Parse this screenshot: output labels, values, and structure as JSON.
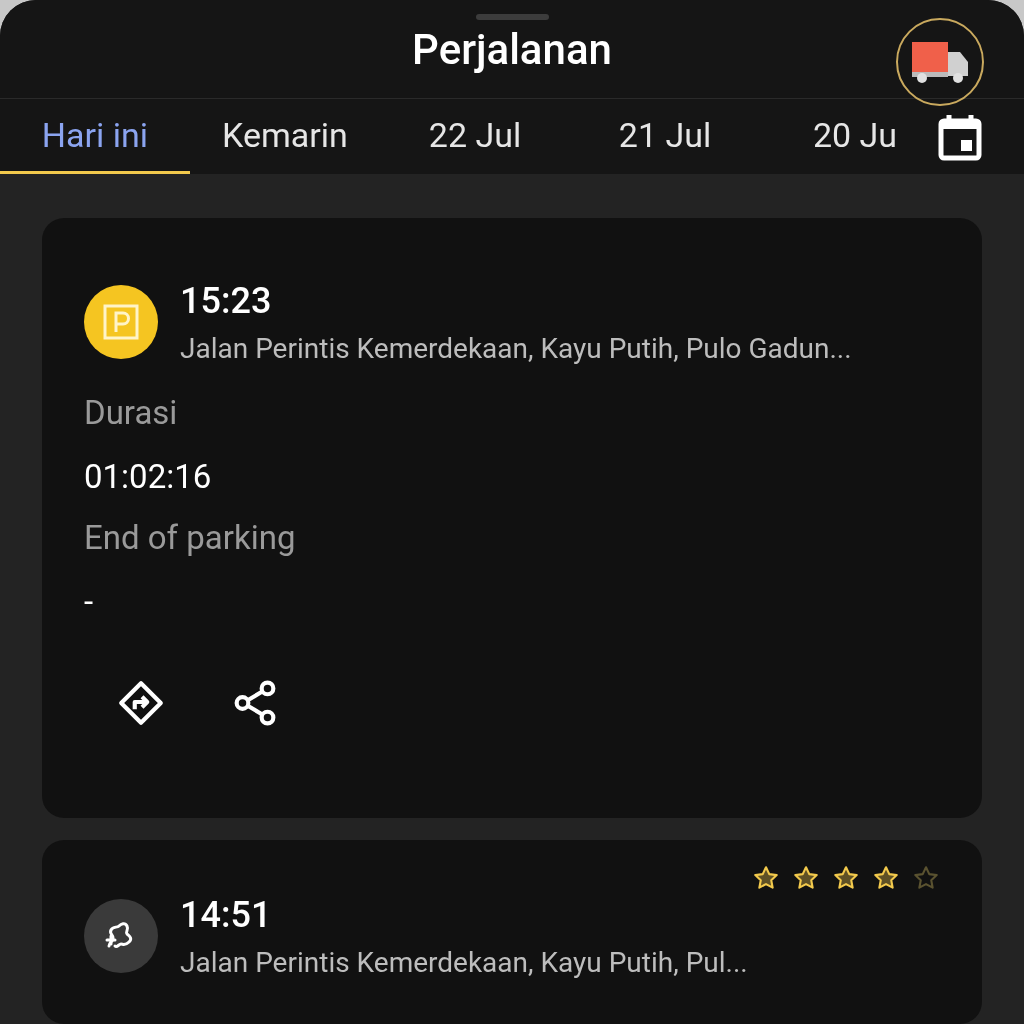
{
  "header": {
    "title": "Perjalanan"
  },
  "tabs": [
    {
      "label": "Hari ini",
      "selected": true
    },
    {
      "label": "Kemarin",
      "selected": false
    },
    {
      "label": "22 Jul",
      "selected": false
    },
    {
      "label": "21 Jul",
      "selected": false
    },
    {
      "label": "20 Ju",
      "selected": false
    }
  ],
  "cards": [
    {
      "kind": "parking",
      "time": "15:23",
      "address": "Jalan Perintis Kemerdekaan, Kayu Putih, Pulo Gadun...",
      "details": [
        {
          "label": "Durasi",
          "value": "01:02:16"
        },
        {
          "label": "End of parking",
          "value": "-"
        }
      ]
    },
    {
      "kind": "trip",
      "time": "14:51",
      "address": "Jalan Perintis Kemerdekaan, Kayu Putih, Pul...",
      "stars": 4
    }
  ]
}
